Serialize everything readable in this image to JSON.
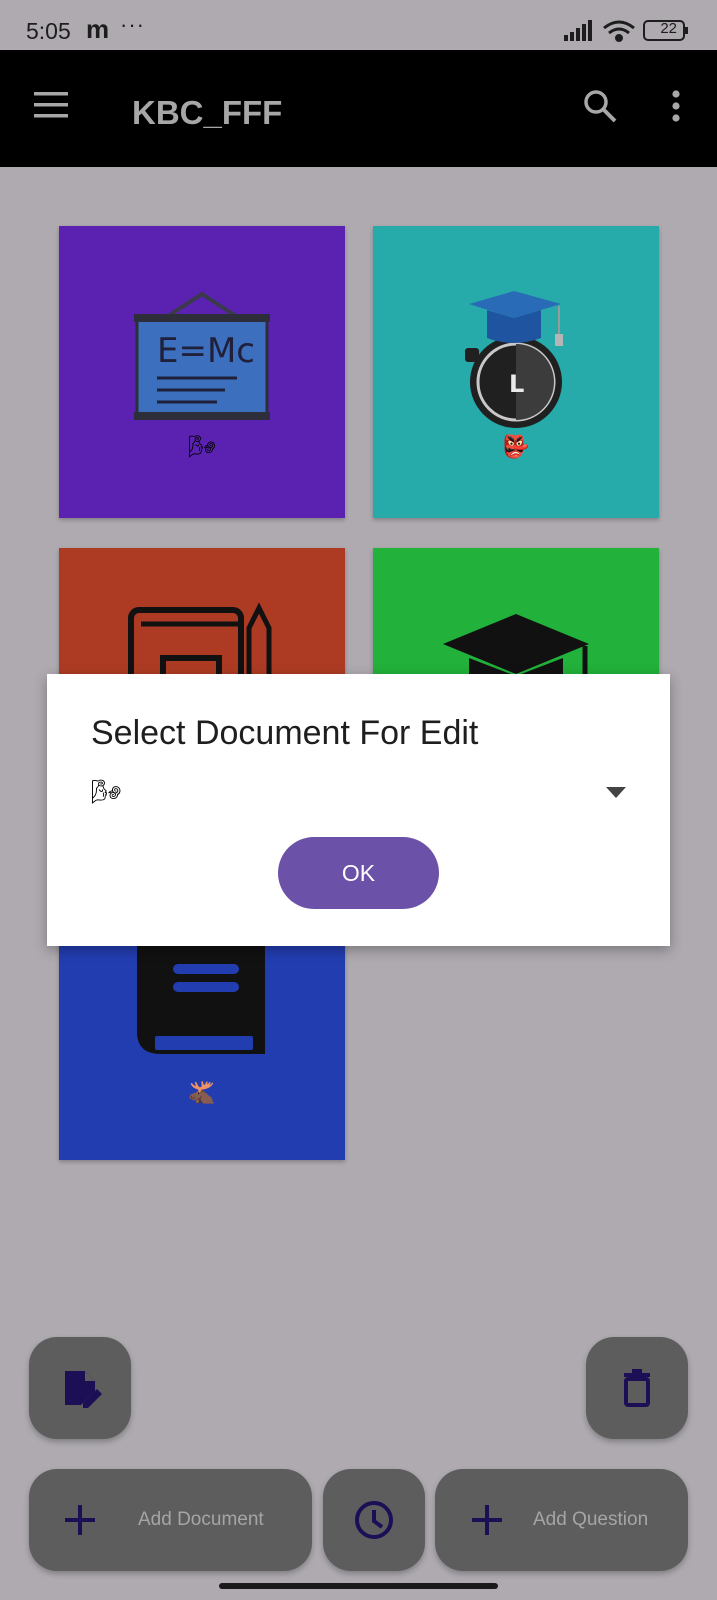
{
  "status_bar": {
    "time": "5:05",
    "carrier_icon": "m",
    "more_dots": "···",
    "battery": "22"
  },
  "app_bar": {
    "title": "KBC_FFF",
    "menu_icon": "hamburger-icon",
    "search_icon": "search-icon",
    "overflow_icon": "more-vert-icon"
  },
  "tiles": [
    {
      "icon": "blackboard-formula-icon",
      "label": "🌬",
      "color": "#5b22b2"
    },
    {
      "icon": "graduation-stopwatch-icon",
      "label": "👺",
      "color": "#26aaaa"
    },
    {
      "icon": "notebook-pencil-icon",
      "label": "",
      "color": "#ad3b23"
    },
    {
      "icon": "graduation-cap-icon",
      "label": "",
      "color": "#22b13a"
    },
    {
      "icon": "book-icon",
      "label": "🫎",
      "color": "#223db0"
    }
  ],
  "dialog": {
    "title": "Select Document For Edit",
    "selected_value": "🌬",
    "ok_label": "OK"
  },
  "actions": {
    "add_document": "Add Document",
    "add_question": "Add Question"
  },
  "colors": {
    "accent": "#6b51a8",
    "scrim": "#aeaab0",
    "fab": "#5d5d5d",
    "fab_icon": "#1d0f56"
  }
}
